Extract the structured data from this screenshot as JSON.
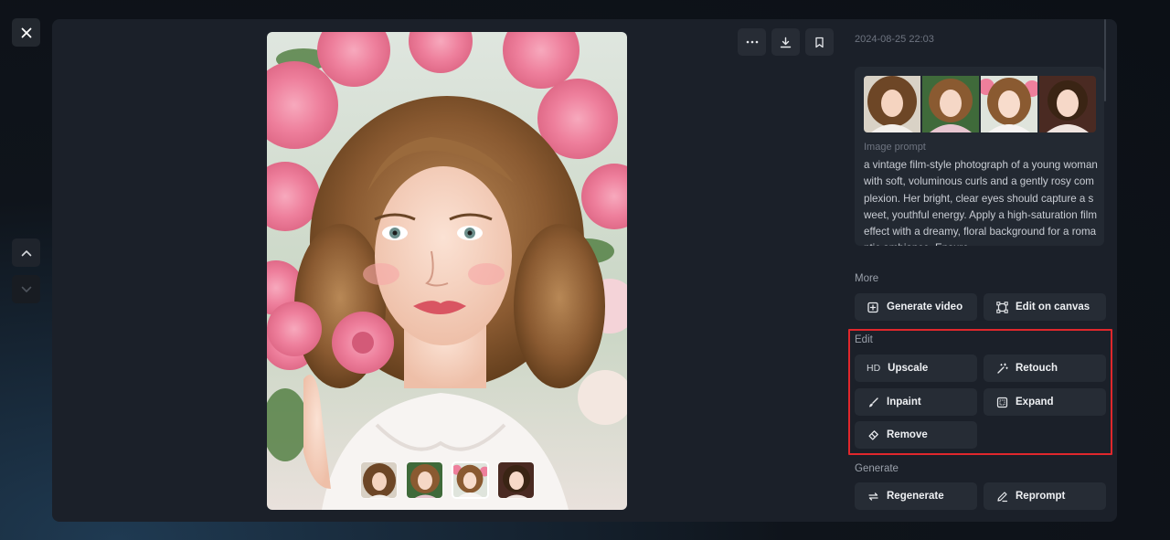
{
  "header": {
    "timestamp": "2024-08-25 22:03"
  },
  "prompt_card": {
    "label": "Image prompt",
    "text": "a vintage film-style photograph of a young woman with soft, voluminous curls and a gently rosy complexion. Her bright, clear eyes should capture a sweet, youthful energy. Apply a high-saturation film effect with a dreamy, floral background for a romantic ambiance. Ensure"
  },
  "sections": {
    "more": {
      "label": "More",
      "buttons": [
        {
          "label": "Generate video",
          "icon": "generate-video-icon"
        },
        {
          "label": "Edit on canvas",
          "icon": "canvas-icon"
        }
      ]
    },
    "edit": {
      "label": "Edit",
      "hd_badge": "HD",
      "buttons": [
        {
          "label": "Upscale",
          "icon": "hd-icon"
        },
        {
          "label": "Retouch",
          "icon": "magic-wand-icon"
        },
        {
          "label": "Inpaint",
          "icon": "brush-icon"
        },
        {
          "label": "Expand",
          "icon": "expand-icon"
        },
        {
          "label": "Remove",
          "icon": "eraser-icon"
        }
      ]
    },
    "generate": {
      "label": "Generate",
      "buttons": [
        {
          "label": "Regenerate",
          "icon": "refresh-icon"
        },
        {
          "label": "Reprompt",
          "icon": "pencil-icon"
        }
      ]
    }
  },
  "colors": {
    "accent_highlight": "#e0272c",
    "panel": "#1b2029",
    "button": "#262c35"
  },
  "thumbnails": {
    "count": 4,
    "selected_index": 2
  }
}
